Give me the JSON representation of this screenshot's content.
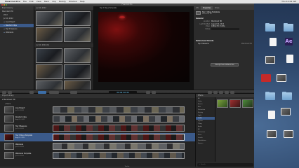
{
  "menubar": {
    "apple": "",
    "items": [
      "Final Cut Pro",
      "File",
      "Edit",
      "View",
      "Mark",
      "Clip",
      "Modify",
      "Window",
      "Help"
    ],
    "clock": "Thu 10:02 AM"
  },
  "desktop_icons": [
    {
      "icon": "folder-icon",
      "label": "Folder"
    },
    {
      "icon": "folder-icon",
      "label": "Folder"
    },
    {
      "icon": "document-icon",
      "label": "Document"
    },
    {
      "icon": "after-effects-icon",
      "label": "Ae"
    },
    {
      "icon": "screenshot-icon",
      "label": "Screen Shot"
    },
    {
      "icon": "document-icon",
      "label": "Document"
    },
    {
      "icon": "red-app-icon",
      "label": "App"
    },
    {
      "icon": "screenshot-icon",
      "label": "Screen Shot"
    },
    {
      "icon": "folder-icon",
      "label": "Folder"
    }
  ],
  "fcp": {
    "title": "Final Cut Pro",
    "event_library": {
      "header": "Event Library",
      "items": [
        {
          "label": "Macintosh HD",
          "selected": false
        },
        {
          "label": "2012",
          "selected": false
        },
        {
          "label": "Jul 10, 2012",
          "selected": false
        },
        {
          "label": "Live Project",
          "selected": false
        },
        {
          "label": "Random Clips",
          "selected": true
        },
        {
          "label": "Top 5 Reasons",
          "selected": false
        },
        {
          "label": "Webisode",
          "selected": false
        }
      ]
    },
    "event_browser": {
      "header": "Jul 10, 2012",
      "group2": "Jul 10, 2012  (6)"
    },
    "viewer": {
      "title": "Top 5 Ways Template"
    },
    "inspector": {
      "tabs": [
        "Info",
        "Properties",
        "Share"
      ],
      "project_name": "Top 5 Ways Template",
      "project_sub": "Macintosh HD",
      "section_general": "General",
      "rows": [
        {
          "k": "Location",
          "v": "Macintosh HD"
        },
        {
          "k": "Last Modified",
          "v": "August 02, 2012"
        },
        {
          "k": "Video",
          "v": "1080p HD 23.98p"
        },
        {
          "k": "Notes",
          "v": ""
        }
      ],
      "section_refs": "Referenced Events",
      "ref_item": "Top 5 Reasons",
      "ref_drive": "Macintosh HD",
      "button": "Modify Event References"
    },
    "toolbar": {
      "timecode": "00:00:00:00"
    },
    "project_library": {
      "header": "Project Library",
      "drive": "Macintosh HD",
      "group_label": "Home",
      "projects": [
        {
          "name": "Live Project",
          "date": "Jul 10, 2012",
          "strip": "a",
          "selected": false
        },
        {
          "name": "Random Clips",
          "date": "Aug 02, 2012",
          "strip": "b",
          "selected": false
        },
        {
          "name": "Top 5 Reasons",
          "date": "Jul 10, 2012",
          "strip": "c",
          "selected": false
        },
        {
          "name": "Top 5 Ways Template",
          "date": "Aug 02, 2012",
          "strip": "c",
          "selected": true
        },
        {
          "name": "Webisode",
          "date": "Jul 10, 2012",
          "strip": "d",
          "selected": false
        },
        {
          "name": "Webisode Template",
          "date": "Jul 10, 2012",
          "strip": "e",
          "selected": false
        }
      ]
    },
    "effects": {
      "header": "Effects",
      "categories": [
        "All",
        "Video",
        "Basics",
        "Blur",
        "Distortion",
        "Keying",
        "Light",
        "Looks",
        "Stylize",
        "Tiling",
        "Audio",
        "All",
        "Distortion",
        "Echo",
        "Levels",
        "Modulation",
        "Spaces"
      ],
      "selected_index": 7,
      "search_placeholder": "Search"
    },
    "status": "Timeline"
  }
}
